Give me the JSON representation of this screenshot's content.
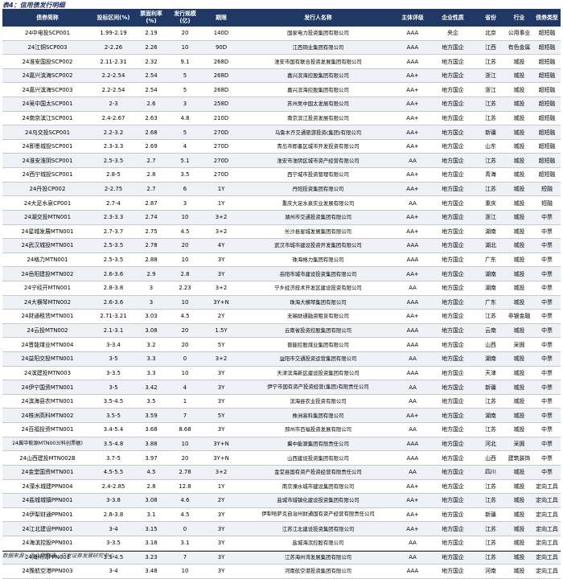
{
  "title": "表4：信用债发行明细",
  "headers": [
    "债券简称",
    "投标区间(%)",
    "票面利率(%)",
    "发行规模(亿)",
    "期限",
    "发行人名称",
    "主体评级",
    "企业性质",
    "省份",
    "行业",
    "债券类型"
  ],
  "rows": [
    [
      "24中电投SCP001",
      "1.99-2.19",
      "2.19",
      "20",
      "140D",
      "国家电力投资集团有限公司",
      "AAA",
      "央企",
      "北京",
      "公用事业",
      "超短融"
    ],
    [
      "24江铜SCP003",
      "2-2.26",
      "2.26",
      "10",
      "90D",
      "江西铜业集团有限公司",
      "AAA",
      "地方国企",
      "江西",
      "有色金属",
      "超短融"
    ],
    [
      "24淮安国投SCP002",
      "2.11-2.31",
      "2.32",
      "9.1",
      "268D",
      "淮安市国有联合投资发展集团有限公司",
      "AAA",
      "地方国企",
      "江苏",
      "城投",
      "超短融"
    ],
    [
      "24嘉兴滨海SCP002",
      "2.2-2.54",
      "2.54",
      "5",
      "268D",
      "嘉兴滨海控股集团有限公司",
      "AA+",
      "地方国企",
      "浙江",
      "城投",
      "超短融"
    ],
    [
      "24嘉兴滨海SCP003",
      "2.2-2.54",
      "2.54",
      "5",
      "268D",
      "嘉兴滨海控股集团有限公司",
      "AA+",
      "地方国企",
      "浙江",
      "城投",
      "超短融"
    ],
    [
      "24吴中国太SCP001",
      "2-3",
      "2.6",
      "3",
      "258D",
      "苏州吴中国太发展有限公司",
      "AA+",
      "地方国企",
      "江苏",
      "城投",
      "超短融"
    ],
    [
      "24南京滨江SCP001",
      "2.4-2.67",
      "2.63",
      "4.8",
      "210D",
      "南京滨江投资发展有限公司",
      "AA+",
      "地方国企",
      "江苏",
      "城投",
      "超短融"
    ],
    [
      "24乌交投SCP001",
      "2.2-3.2",
      "2.68",
      "5",
      "270D",
      "乌鲁木齐交通旅游投资(集团)有限公司",
      "AA+",
      "地方国企",
      "新疆",
      "城投",
      "超短融"
    ],
    [
      "24即墨城投SCP001",
      "2.3-3.3",
      "2.69",
      "4",
      "270D",
      "青岛市即墨区城市开发投资有限公司",
      "AA+",
      "地方国企",
      "山东",
      "城投",
      "超短融"
    ],
    [
      "24淮安淮阴SCP001",
      "2.5-3.5",
      "2.7",
      "5.1",
      "270D",
      "淮安市淮阴区城市资产经营有限公司",
      "AA",
      "地方国企",
      "江苏",
      "城投",
      "超短融"
    ],
    [
      "24西宁城投SCP001",
      "2.8-5",
      "2.8",
      "3.5",
      "270D",
      "西宁城市投资管理有限公司",
      "AA+",
      "地方国企",
      "青海",
      "城投",
      "超短融"
    ],
    [
      "24丹投CP002",
      "2-2.75",
      "2.7",
      "6",
      "1Y",
      "丹阳投资集团有限公司",
      "AA+",
      "地方国企",
      "江苏",
      "城投",
      "短融"
    ],
    [
      "24大足水泉CP001",
      "2.7-4",
      "2.87",
      "3",
      "1Y",
      "重庆大足水泉实业发展有限公司",
      "AA",
      "地方国企",
      "重庆",
      "城投",
      "短融"
    ],
    [
      "24湖交投MTN001",
      "2.3-3.3",
      "2.74",
      "10",
      "3+2",
      "湖州市交通投资集团有限公司",
      "AA+",
      "地方国企",
      "浙江",
      "城投",
      "中票"
    ],
    [
      "24星城发展MTN001",
      "2.7-3.7",
      "2.75",
      "4.5",
      "3+2",
      "长沙县星城发展集团有限公司",
      "AA+",
      "地方国企",
      "湖南",
      "城投",
      "中票"
    ],
    [
      "24武汉城投MTN001",
      "2.5-3.5",
      "2.78",
      "20",
      "4Y",
      "武汉市城市建设投资开发集团有限公司",
      "AAA",
      "地方国企",
      "湖北",
      "城投",
      "中票"
    ],
    [
      "24格力MTN001",
      "2.5-3.5",
      "2.88",
      "10",
      "3Y",
      "珠海格力集团有限公司",
      "AAA",
      "地方国企",
      "广东",
      "城投",
      "中票"
    ],
    [
      "24岳阳建投MTN002",
      "2.6-3.6",
      "2.9",
      "2.8",
      "3Y",
      "岳阳市城市建设投资集团有限公司",
      "AA+",
      "地方国企",
      "湖南",
      "城投",
      "中票"
    ],
    [
      "24宁经开MTN001",
      "2.8-3.8",
      "3",
      "2.23",
      "3+2",
      "宁乡经济技术开发区建设投资有限公司",
      "AA",
      "地方国企",
      "湖南",
      "城投",
      "中票"
    ],
    [
      "24大横琴MTN002",
      "2.6-3.6",
      "3",
      "10",
      "3Y+N",
      "珠海大横琴集团有限公司",
      "AAA",
      "地方国企",
      "广东",
      "城投",
      "中票"
    ],
    [
      "24财通租赁MTN001",
      "2.71-3.21",
      "3.03",
      "4.5",
      "2Y",
      "无锡财通融资租赁有限公司",
      "AA+",
      "地方国企",
      "江苏",
      "非银金融",
      "中票"
    ],
    [
      "24云投MTN002",
      "2.1-3.1",
      "3.08",
      "20",
      "1.5Y",
      "云南省投资控股集团有限公司",
      "AAA",
      "地方国企",
      "云南",
      "城投",
      "中票"
    ],
    [
      "24晋能煤业MTN004",
      "3-3.4",
      "3.2",
      "20",
      "5Y",
      "晋能控股煤业集团有限公司",
      "AAA",
      "地方国企",
      "山西",
      "采掘",
      "中票"
    ],
    [
      "24益阳交投MTN001",
      "3-5",
      "3.3",
      "0",
      "3+2",
      "益阳市交通投资运营集团有限公司",
      "AA",
      "地方国企",
      "湖南",
      "城投",
      "中票"
    ],
    [
      "24滨建投MTN003",
      "3-3.5",
      "3.3",
      "10",
      "3Y",
      "天津滨海新区建设投资集团有限公司",
      "AAA",
      "地方国企",
      "天津",
      "城投",
      "中票"
    ],
    [
      "24伊宁国资MTN001",
      "3-5",
      "3.42",
      "4",
      "3Y",
      "伊宁市国有资产投资经营(集团)有限责任公司",
      "AA",
      "地方国企",
      "新疆",
      "城投",
      "中票"
    ],
    [
      "24滨海县农MTN001",
      "3.5-4.5",
      "3.5",
      "1",
      "3Y",
      "滨海县农业投资有限公司",
      "AA",
      "地方国企",
      "江苏",
      "城投",
      "中票"
    ],
    [
      "24株洲高科MTN002",
      "3.5-5",
      "3.59",
      "7",
      "5Y",
      "株洲高科集团有限公司",
      "AA+",
      "地方国企",
      "湖南",
      "城投",
      "中票"
    ],
    [
      "24百福投资MTN001",
      "3.4-5.4",
      "3.68",
      "8.68",
      "3Y",
      "邳州市百福投资发展有限公司",
      "AA",
      "地方国企",
      "江苏",
      "城投",
      "中票"
    ],
    [
      "24冀中能源MTN003(科创票据)",
      "3.5-4.8",
      "3.88",
      "10",
      "3Y+N",
      "冀中能源集团有限责任公司",
      "AAA",
      "地方国企",
      "河北",
      "采掘",
      "中票"
    ],
    [
      "24山西建投MTN002B",
      "3.7-5",
      "3.97",
      "20",
      "3Y+N",
      "山西建设投资集团有限公司",
      "AAA",
      "地方国企",
      "山西",
      "建筑装饰",
      "中票"
    ],
    [
      "24金堂国资MTN001",
      "4.5-5.5",
      "4.5",
      "2.78",
      "3+2",
      "金堂县国有资产投资经营有限责任公司",
      "AA",
      "地方国企",
      "四川",
      "城投",
      "中票"
    ],
    [
      "24溧水城建PPN004",
      "2.4-2.85",
      "2.8",
      "12.8",
      "1Y",
      "南京溧水城市建设集团有限公司",
      "AA+",
      "地方国企",
      "江苏",
      "城投",
      "定向工具"
    ],
    [
      "24盐城城镇PPN001",
      "3-3.8",
      "3.08",
      "4.6",
      "2Y",
      "盐城市城镇化建设投资集团有限公司",
      "AA+",
      "地方国企",
      "江苏",
      "城投",
      "定向工具"
    ],
    [
      "24伊犁财通PPN001",
      "2.8-3.8",
      "3.1",
      "4.5",
      "3Y",
      "伊犁哈萨克自治州财通国有资产经营有限责任公司",
      "AA+",
      "地方国企",
      "新疆",
      "城投",
      "定向工具"
    ],
    [
      "24江北建设PPN001",
      "3-4",
      "3.15",
      "0",
      "3Y",
      "江苏江北建设投资集团有限公司",
      "AA+",
      "地方国企",
      "江苏",
      "城投",
      "定向工具"
    ],
    [
      "24海滨控股PPN001",
      "3-3.5",
      "3.18",
      "3.1",
      "3Y",
      "盐城海滨控股有限公司",
      "AA",
      "地方国企",
      "江苏",
      "城投",
      "定向工具"
    ],
    [
      "24海州湾PPN001",
      "3.5-4.5",
      "3.23",
      "7",
      "3Y",
      "江苏海州湾发展集团有限公司",
      "AA",
      "地方国企",
      "江苏",
      "城投",
      "定向工具"
    ],
    [
      "24豫航空港PPN003",
      "3-4",
      "3.48",
      "10",
      "3Y",
      "河南航空港投资集团有限公司",
      "AAA",
      "地方国企",
      "河南",
      "城投",
      "定向工具"
    ]
  ],
  "source": "数据来源：企业预警通，广发证券发展研究中心"
}
